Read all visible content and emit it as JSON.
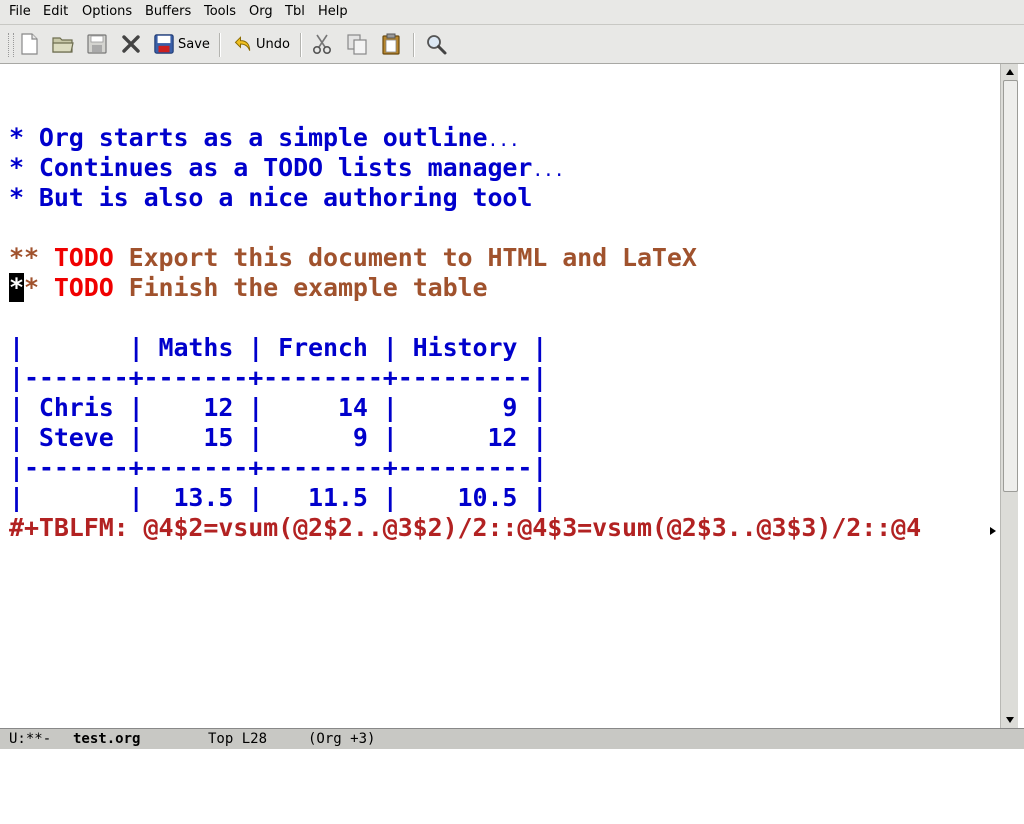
{
  "menubar": {
    "items": [
      "File",
      "Edit",
      "Options",
      "Buffers",
      "Tools",
      "Org",
      "Tbl",
      "Help"
    ]
  },
  "toolbar": {
    "buttons": [
      {
        "icon": "new-file-icon"
      },
      {
        "icon": "open-folder-icon"
      },
      {
        "icon": "save-disk-icon"
      },
      {
        "icon": "close-x-icon"
      },
      {
        "icon": "save-icon",
        "label": "Save"
      },
      {
        "icon": "undo-icon",
        "label": "Undo"
      },
      {
        "icon": "cut-icon"
      },
      {
        "icon": "copy-icon"
      },
      {
        "icon": "paste-icon"
      },
      {
        "icon": "search-icon"
      }
    ]
  },
  "buffer": {
    "headings": [
      {
        "stars": "*",
        "text": "Org starts as a simple outline",
        "ellipsis": "..."
      },
      {
        "stars": "*",
        "text": "Continues as a TODO lists manager",
        "ellipsis": "..."
      },
      {
        "stars": "*",
        "text": "But is also a nice authoring tool",
        "ellipsis": ""
      }
    ],
    "todos": [
      {
        "stars": "**",
        "keyword": "TODO",
        "text": "Export this document to HTML and LaTeX"
      },
      {
        "stars": "**",
        "keyword": "TODO",
        "text": "Finish the example table"
      }
    ],
    "table": {
      "header": "|       | Maths | French | History |",
      "rule": "|-------+-------+--------+---------|",
      "rows": [
        "| Chris |    12 |     14 |       9 |",
        "| Steve |    15 |      9 |      12 |"
      ],
      "rule2": "|-------+-------+--------+---------|",
      "totals": "|       |  13.5 |   11.5 |    10.5 |"
    },
    "formula": "#+TBLFM: @4$2=vsum(@2$2..@3$2)/2::@4$3=vsum(@2$3..@3$3)/2::@4"
  },
  "modeline": {
    "status": "U:**-",
    "buffer_name": "test.org",
    "position": "Top L28",
    "mode": "(Org +3)"
  },
  "colors": {
    "heading": "#0000cc",
    "todo_keyword": "#f00000",
    "level2_text": "#a0522d",
    "formula": "#b22222"
  }
}
